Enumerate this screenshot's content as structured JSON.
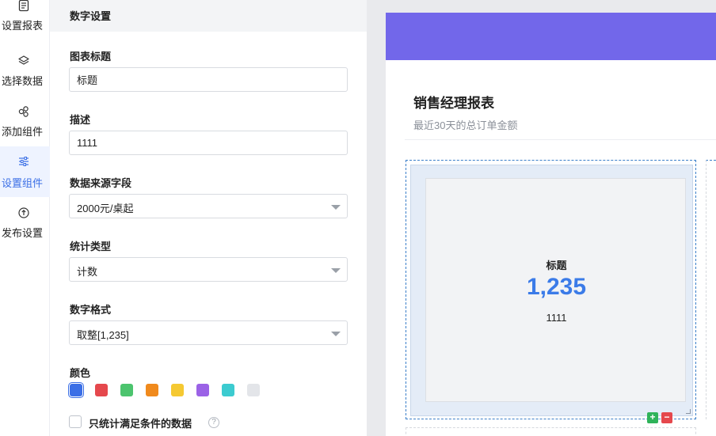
{
  "rail": {
    "items": [
      {
        "label": "设置报表",
        "icon": "report-icon",
        "active": false
      },
      {
        "label": "选择数据",
        "icon": "layers-icon",
        "active": false
      },
      {
        "label": "添加组件",
        "icon": "components-icon",
        "active": false
      },
      {
        "label": "设置组件",
        "icon": "sliders-icon",
        "active": true
      },
      {
        "label": "发布设置",
        "icon": "publish-icon",
        "active": false
      }
    ]
  },
  "panel": {
    "title": "数字设置",
    "chart_title": {
      "label": "图表标题",
      "value": "标题"
    },
    "description": {
      "label": "描述",
      "value": "1111"
    },
    "data_field": {
      "label": "数据来源字段",
      "value": "2000元/桌起"
    },
    "stat_type": {
      "label": "统计类型",
      "value": "计数"
    },
    "number_format": {
      "label": "数字格式",
      "value": "取整[1,235]"
    },
    "color": {
      "label": "颜色",
      "swatches": [
        "#3b6fe6",
        "#e5484d",
        "#4cc46e",
        "#f08a1d",
        "#f5c932",
        "#9b62e6",
        "#3ccbd0",
        "#e3e5e9"
      ],
      "selected": 0
    },
    "filter_checkbox": {
      "label": "只统计满足条件的数据",
      "checked": false,
      "help": "?"
    }
  },
  "preview": {
    "accent": "#7267ea",
    "report_title": "销售经理报表",
    "report_desc": "最近30天的总订单金额",
    "card": {
      "title": "标题",
      "value": "1,235",
      "desc": "1111",
      "value_color": "#3b7be8"
    },
    "actions": {
      "add": "+",
      "delete": "−"
    }
  }
}
